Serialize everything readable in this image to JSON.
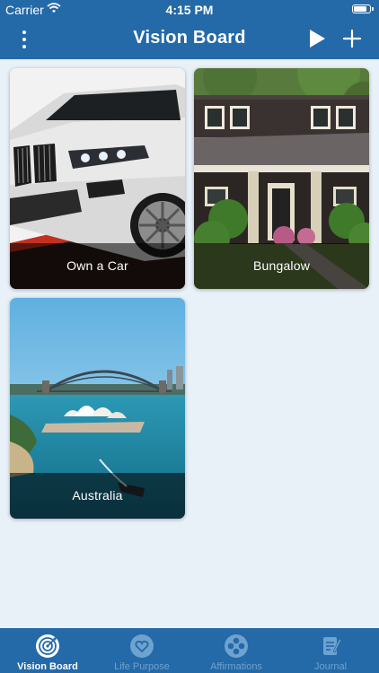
{
  "status_bar": {
    "carrier": "Carrier",
    "time": "4:15 PM",
    "battery_level": 0.9
  },
  "header": {
    "title": "Vision Board"
  },
  "cards": [
    {
      "label": "Own a Car",
      "image": "white-suv-photo"
    },
    {
      "label": "Bungalow",
      "image": "house-with-porch-photo"
    },
    {
      "label": "Australia",
      "image": "sydney-harbour-photo"
    }
  ],
  "tabs": [
    {
      "label": "Vision Board",
      "icon": "target-icon",
      "active": true
    },
    {
      "label": "Life Purpose",
      "icon": "heart-icon",
      "active": false
    },
    {
      "label": "Affirmations",
      "icon": "reel-icon",
      "active": false
    },
    {
      "label": "Journal",
      "icon": "journal-icon",
      "active": false
    }
  ],
  "colors": {
    "primary": "#2469a8",
    "background": "#e8f0f8",
    "tab_inactive": "#6ea2cf"
  }
}
